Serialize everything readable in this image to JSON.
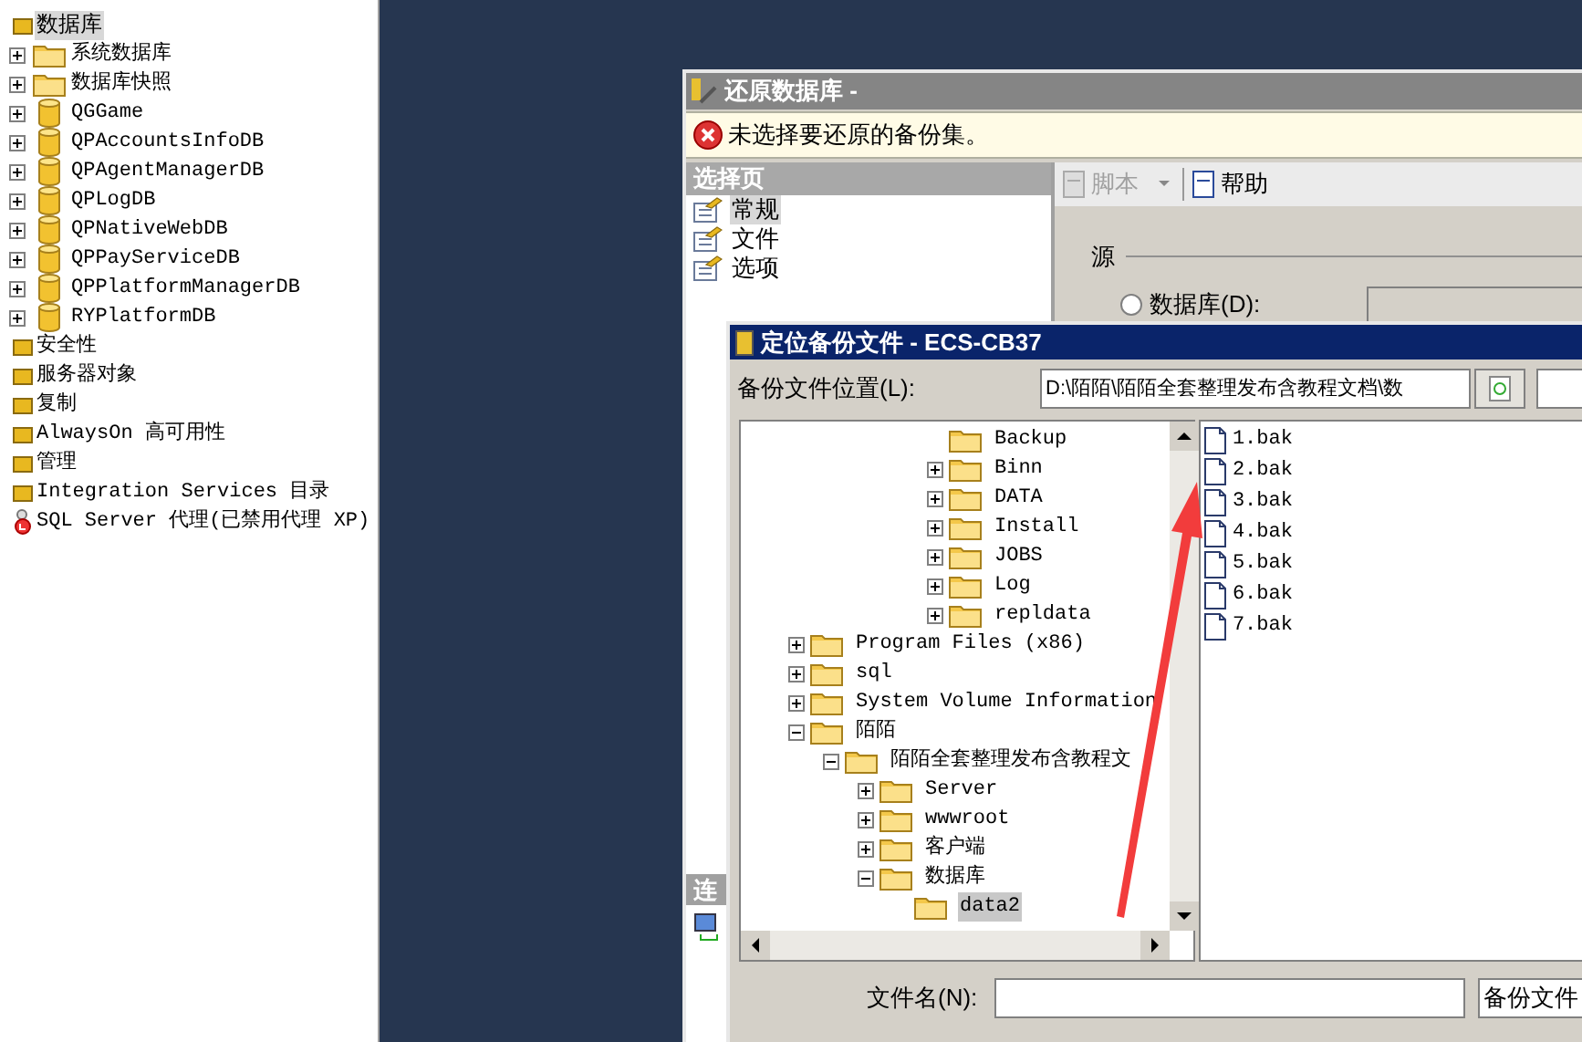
{
  "object_explorer": {
    "root": {
      "label": "数据库",
      "selected": true,
      "children": [
        {
          "kind": "folder",
          "label": "系统数据库",
          "expanded": false,
          "selected": false
        },
        {
          "kind": "folder",
          "label": "数据库快照",
          "expanded": false,
          "selected": false
        },
        {
          "kind": "database",
          "label": "QGGame",
          "expanded": false,
          "selected": false
        },
        {
          "kind": "database",
          "label": "QPAccountsInfoDB",
          "expanded": false,
          "selected": false
        },
        {
          "kind": "database",
          "label": "QPAgentManagerDB",
          "expanded": false,
          "selected": false
        },
        {
          "kind": "database",
          "label": "QPLogDB",
          "expanded": false,
          "selected": false
        },
        {
          "kind": "database",
          "label": "QPNativeWebDB",
          "expanded": false,
          "selected": false
        },
        {
          "kind": "database",
          "label": "QPPayServiceDB",
          "expanded": false,
          "selected": false
        },
        {
          "kind": "database",
          "label": "QPPlatformManagerDB",
          "expanded": false,
          "selected": false
        },
        {
          "kind": "database",
          "label": "RYPlatformDB",
          "expanded": false,
          "selected": false
        }
      ]
    },
    "items": [
      {
        "kind": "node",
        "label": "安全性",
        "selected": false
      },
      {
        "kind": "node",
        "label": "服务器对象",
        "selected": false
      },
      {
        "kind": "node",
        "label": "复制",
        "selected": false
      },
      {
        "kind": "node",
        "label": "AlwaysOn 高可用性",
        "selected": false
      },
      {
        "kind": "node",
        "label": "管理",
        "selected": false
      },
      {
        "kind": "node",
        "label": "Integration Services 目录",
        "selected": false
      },
      {
        "kind": "agent",
        "label": "SQL Server 代理(已禁用代理 XP)",
        "selected": false
      }
    ]
  },
  "restore_dialog": {
    "title": "还原数据库 -",
    "message": "未选择要还原的备份集。",
    "select_page": {
      "header": "选择页",
      "items": [
        {
          "label": "常规",
          "selected": true
        },
        {
          "label": "文件",
          "selected": false
        },
        {
          "label": "选项",
          "selected": false
        }
      ]
    },
    "connection_header": "连",
    "toolbar": [
      {
        "label": "脚本",
        "disabled": true,
        "dropdown": true
      },
      {
        "label": "帮助",
        "disabled": false,
        "dropdown": false
      }
    ],
    "source": {
      "label": "源",
      "option": {
        "label": "数据库(D):",
        "selected": false
      }
    }
  },
  "locate_dialog": {
    "title": "定位备份文件 - ECS-CB37",
    "location_label": "备份文件位置(L):",
    "location_value": "D:\\陌陌\\陌陌全套整理发布含教程文档\\数",
    "folder_tree": {
      "scrolled_branch": [
        {
          "label": "Backup",
          "selected": false
        },
        {
          "label": "Binn",
          "expanded": false,
          "selected": false
        },
        {
          "label": "DATA",
          "expanded": false,
          "selected": false
        },
        {
          "label": "Install",
          "expanded": false,
          "selected": false
        },
        {
          "label": "JOBS",
          "expanded": false,
          "selected": false
        },
        {
          "label": "Log",
          "expanded": false,
          "selected": false
        },
        {
          "label": "repldata",
          "expanded": false,
          "selected": false
        }
      ],
      "items": [
        {
          "label": "Program Files (x86)",
          "expanded": false,
          "selected": false
        },
        {
          "label": "sql",
          "expanded": false,
          "selected": false
        },
        {
          "label": "System Volume Information",
          "expanded": false,
          "selected": false
        },
        {
          "label": "陌陌",
          "expanded": true,
          "selected": false,
          "children": [
            {
              "label": "陌陌全套整理发布含教程文",
              "expanded": true,
              "selected": false,
              "children": [
                {
                  "label": "Server",
                  "expanded": false,
                  "selected": false
                },
                {
                  "label": "wwwroot",
                  "expanded": false,
                  "selected": false
                },
                {
                  "label": "客户端",
                  "expanded": false,
                  "selected": false
                },
                {
                  "label": "数据库",
                  "expanded": true,
                  "selected": false,
                  "children": [
                    {
                      "label": "data2",
                      "selected": true
                    }
                  ]
                }
              ]
            }
          ]
        }
      ]
    },
    "files": [
      "1.bak",
      "2.bak",
      "3.bak",
      "4.bak",
      "5.bak",
      "6.bak",
      "7.bak"
    ],
    "file_name_label": "文件名(N):",
    "file_type": "备份文件"
  }
}
